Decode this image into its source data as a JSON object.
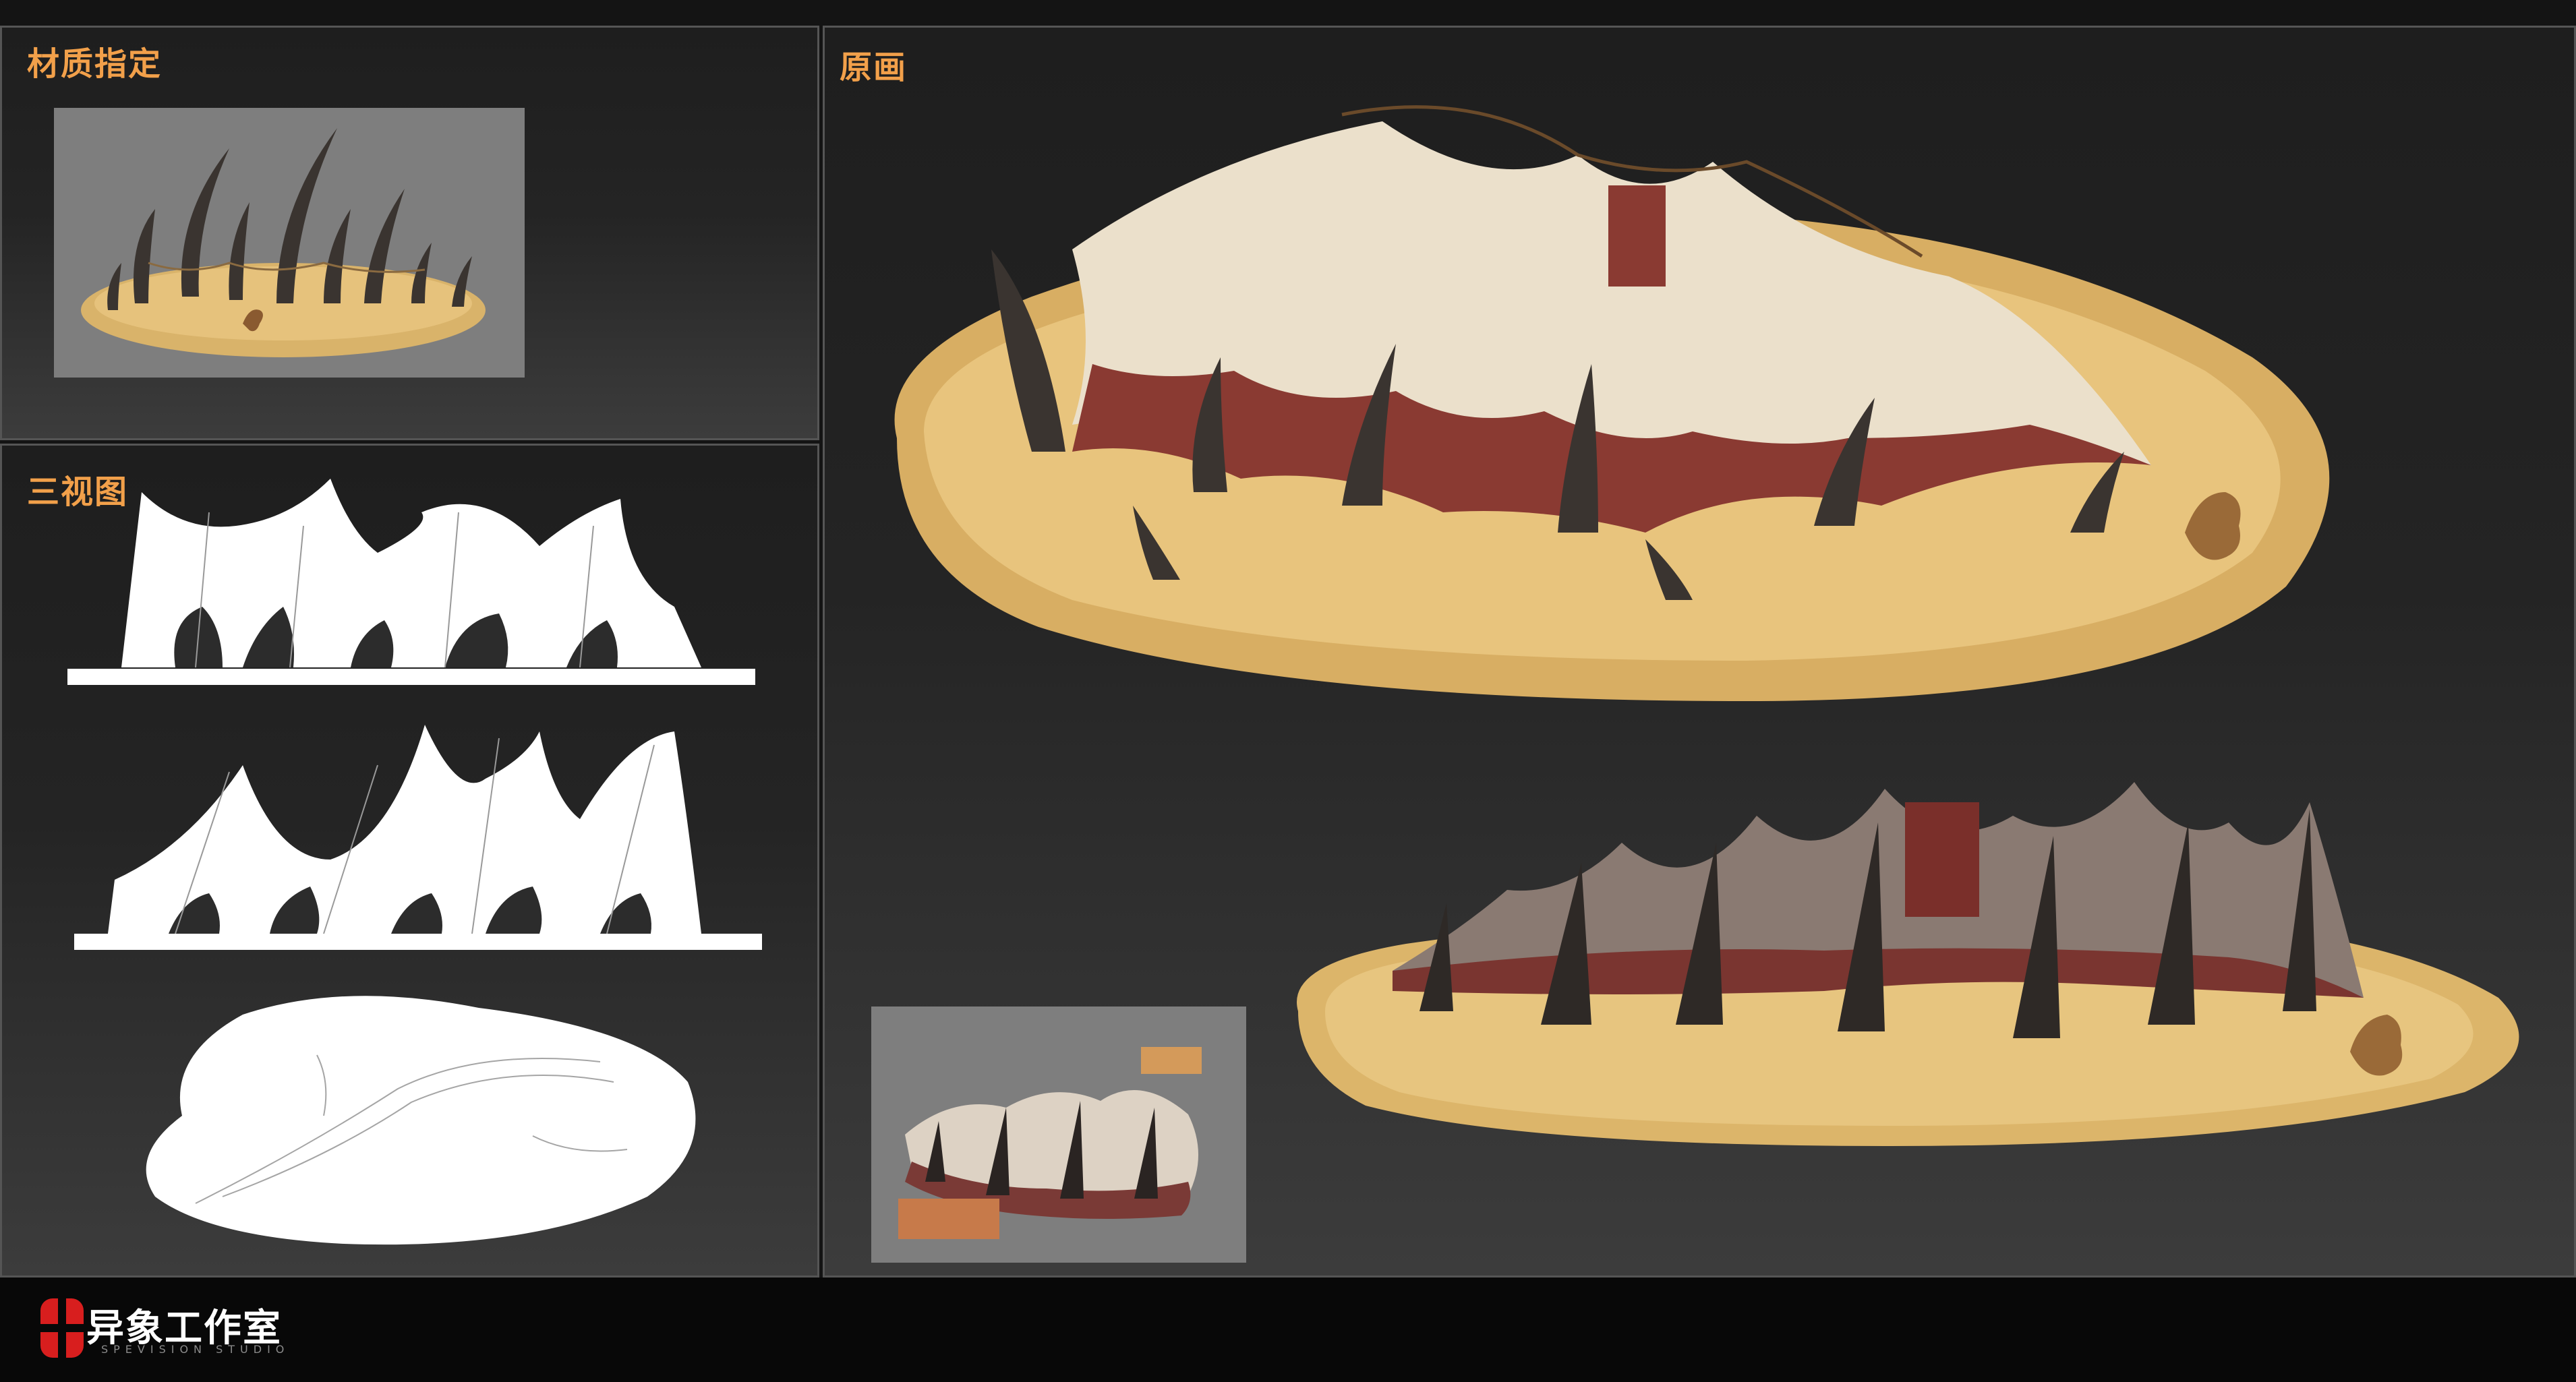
{
  "panels": {
    "material": {
      "title": "材质指定"
    },
    "three_view": {
      "title": "三视图"
    },
    "concept": {
      "title": "原画"
    }
  },
  "footer": {
    "logo_text": "异象工作室",
    "logo_sub": "SPEVISION STUDIO"
  },
  "colors": {
    "accent": "#f2a04a",
    "sand": "#e3bd72",
    "cloth_light": "#ede3d0",
    "cloth_red": "#8a3a32",
    "horn": "#3a3430",
    "thumb_bg": "#7e7e7e"
  }
}
